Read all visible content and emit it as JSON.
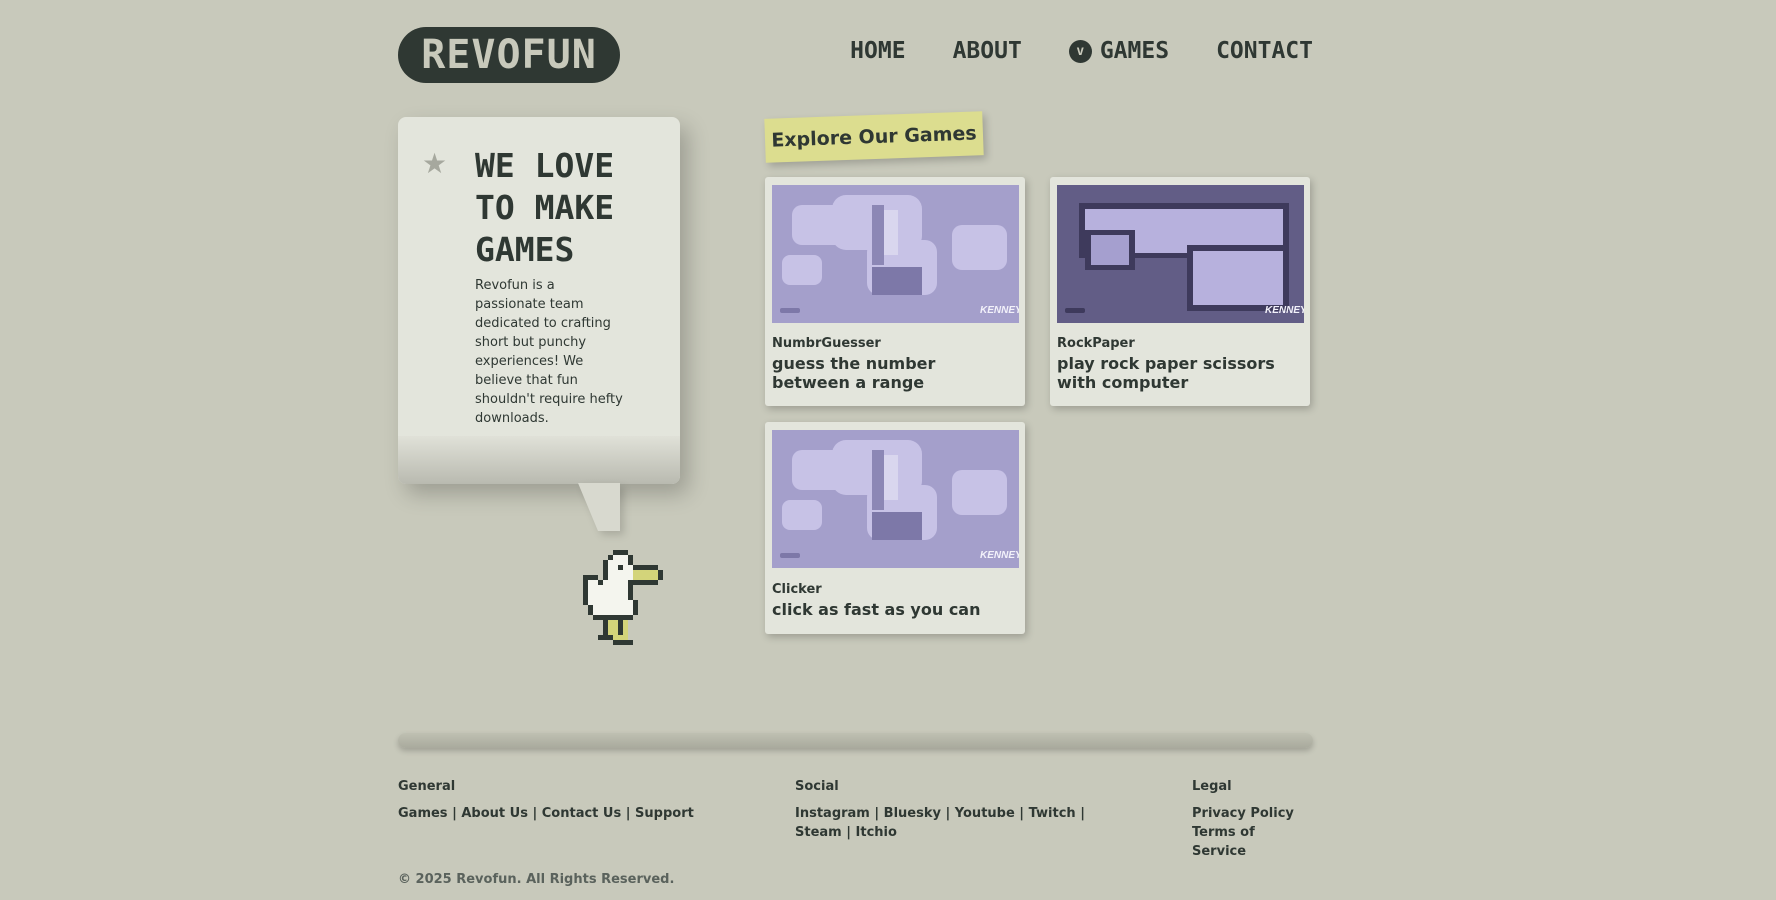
{
  "header": {
    "logo": "REVOFUN",
    "nav": [
      {
        "label": "HOME"
      },
      {
        "label": "ABOUT"
      },
      {
        "label": "GAMES",
        "marker": "v"
      },
      {
        "label": "CONTACT"
      }
    ]
  },
  "hero": {
    "heading": "WE LOVE TO MAKE GAMES",
    "body": "Revofun is a passionate team dedicated to crafting short but punchy experiences! We believe that fun shouldn't require hefty downloads."
  },
  "games": {
    "section_label": "Explore Our Games",
    "items": [
      {
        "name": "NumbrGuesser",
        "description": "guess the number between a range",
        "thumb_credit": "KENNEY"
      },
      {
        "name": "RockPaper",
        "description": "play rock paper scissors with computer",
        "thumb_credit": "KENNEY"
      },
      {
        "name": "Clicker",
        "description": "click as fast as you can",
        "thumb_credit": "KENNEY"
      }
    ]
  },
  "footer": {
    "general": {
      "title": "General",
      "links": [
        "Games",
        "About Us",
        "Contact Us",
        "Support"
      ]
    },
    "social": {
      "title": "Social",
      "links": [
        "Instagram",
        "Bluesky",
        "Youtube",
        "Twitch",
        "Steam",
        "Itchio"
      ]
    },
    "legal": {
      "title": "Legal",
      "links": [
        "Privacy Policy",
        "Terms of Service"
      ]
    },
    "copyright": "© 2025 Revofun. All Rights Reserved."
  },
  "colors": {
    "background": "#c8c9bb",
    "dark": "#2f3833",
    "card": "#e3e5dc",
    "highlight": "#dcdd8f",
    "thumb": "#a49fcb"
  }
}
